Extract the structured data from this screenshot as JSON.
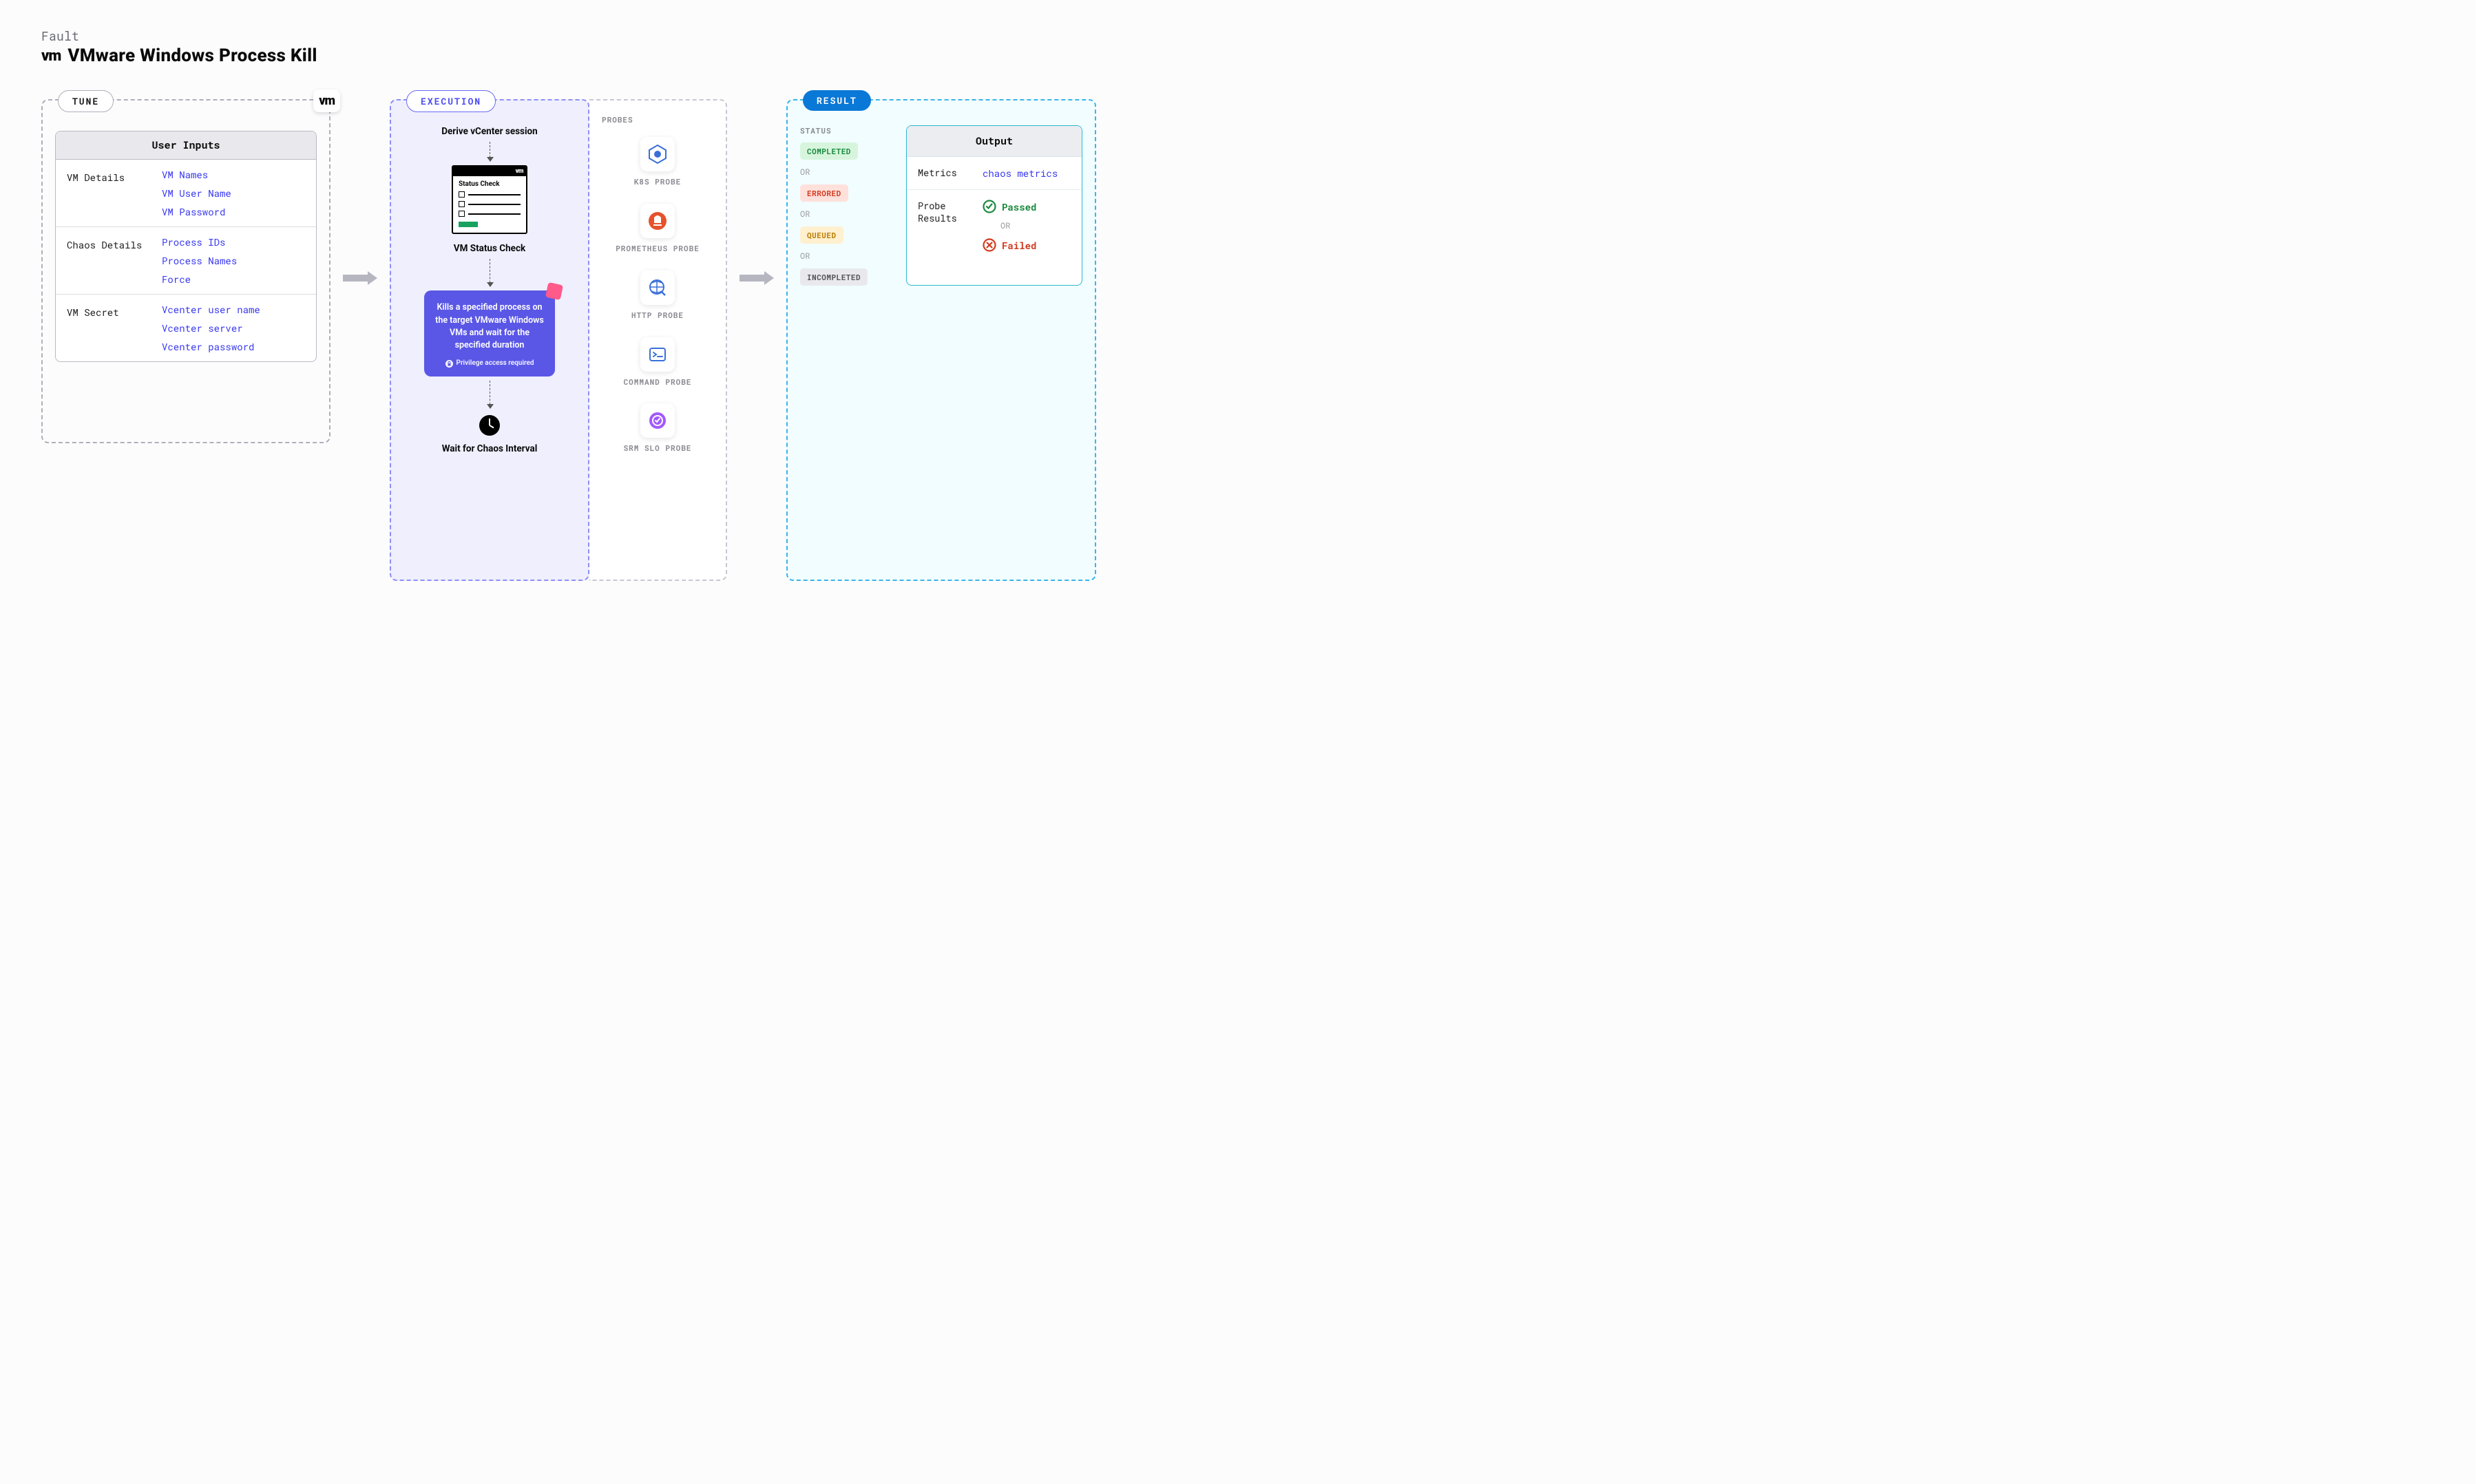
{
  "header": {
    "kicker": "Fault",
    "title": "VMware Windows Process Kill",
    "logo": "vm"
  },
  "tune": {
    "tag": "TUNE",
    "badge": "vm",
    "card_title": "User Inputs",
    "sections": [
      {
        "label": "VM Details",
        "values": [
          "VM Names",
          "VM User Name",
          "VM Password"
        ]
      },
      {
        "label": "Chaos Details",
        "values": [
          "Process IDs",
          "Process Names",
          "Force"
        ]
      },
      {
        "label": "VM Secret",
        "values": [
          "Vcenter user name",
          "Vcenter server",
          "Vcenter password"
        ]
      }
    ]
  },
  "execution": {
    "tag": "EXECUTION",
    "step1": "Derive vCenter session",
    "status_card": {
      "bar_logo": "vm",
      "title": "Status Check"
    },
    "step2": "VM Status Check",
    "action": {
      "text": "Kills a specified process on the target VMware Windows VMs and wait for the specified duration",
      "privilege": "Privilege access required"
    },
    "step3": "Wait for Chaos Interval"
  },
  "probes": {
    "title": "PROBES",
    "items": [
      {
        "name": "K8S PROBE",
        "icon": "k8s"
      },
      {
        "name": "PROMETHEUS PROBE",
        "icon": "prometheus"
      },
      {
        "name": "HTTP PROBE",
        "icon": "http"
      },
      {
        "name": "COMMAND PROBE",
        "icon": "command"
      },
      {
        "name": "SRM SLO PROBE",
        "icon": "srm"
      }
    ]
  },
  "result": {
    "tag": "RESULT",
    "status_label": "STATUS",
    "or": "OR",
    "statuses": [
      "COMPLETED",
      "ERRORED",
      "QUEUED",
      "INCOMPLETED"
    ],
    "output": {
      "title": "Output",
      "metrics_label": "Metrics",
      "metrics_value": "chaos metrics",
      "probe_label": "Probe Results",
      "passed": "Passed",
      "failed": "Failed"
    }
  }
}
